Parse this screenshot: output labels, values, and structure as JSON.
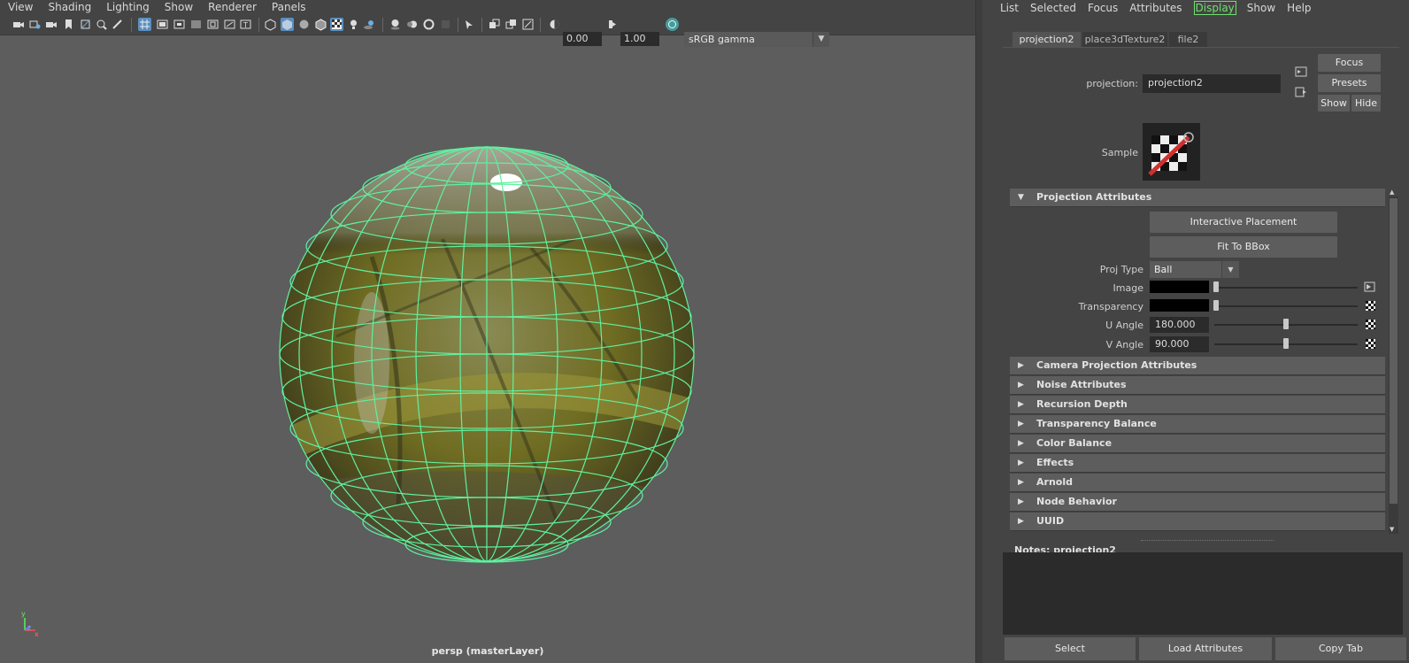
{
  "viewport": {
    "menu": [
      "View",
      "Shading",
      "Lighting",
      "Show",
      "Renderer",
      "Panels"
    ],
    "toolbar": {
      "exposure": "0.00",
      "gamma": "1.00",
      "color_space": "sRGB gamma"
    },
    "camera_label": "persp (masterLayer)",
    "axis": {
      "y": "y",
      "x": "x",
      "z": "z"
    },
    "wireframe_color": "#5ff0a0"
  },
  "attribute_editor": {
    "menu": [
      "List",
      "Selected",
      "Focus",
      "Attributes",
      "Display",
      "Show",
      "Help"
    ],
    "highlighted_menu": "Display",
    "tabs": [
      "projection2",
      "place3dTexture2",
      "file2"
    ],
    "node_label": "projection:",
    "node_value": "projection2",
    "buttons": {
      "focus": "Focus",
      "presets": "Presets",
      "show": "Show",
      "hide": "Hide"
    },
    "sample_label": "Sample",
    "projection_section": {
      "title": "Projection Attributes",
      "interactive_placement": "Interactive Placement",
      "fit_to_bbox": "Fit To BBox",
      "proj_type_label": "Proj Type",
      "proj_type_value": "Ball",
      "image_label": "Image",
      "transparency_label": "Transparency",
      "u_angle_label": "U Angle",
      "u_angle_value": "180.000",
      "v_angle_label": "V Angle",
      "v_angle_value": "90.000"
    },
    "collapsed_sections": [
      "Camera Projection Attributes",
      "Noise Attributes",
      "Recursion Depth",
      "Transparency Balance",
      "Color Balance",
      "Effects",
      "Arnold",
      "Node Behavior",
      "UUID"
    ],
    "notes_label": "Notes:  projection2",
    "bottom_buttons": {
      "select": "Select",
      "load": "Load Attributes",
      "copy": "Copy Tab"
    }
  }
}
